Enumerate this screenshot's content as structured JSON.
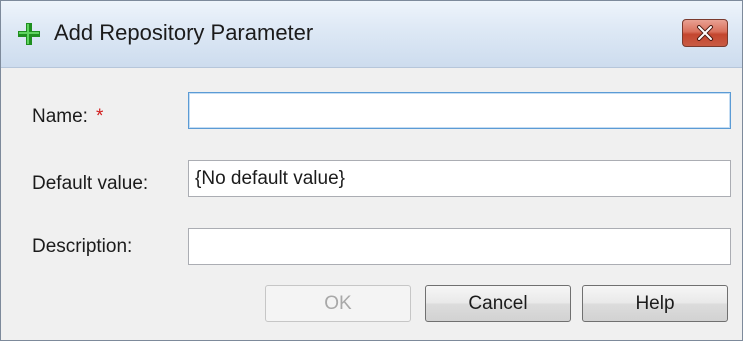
{
  "window": {
    "title": "Add Repository Parameter",
    "title_icon": "green-plus-icon",
    "close_icon": "close-icon",
    "accent_color": "#2e9d2e",
    "close_color": "#c4462f"
  },
  "form": {
    "name_label": "Name:",
    "required_marker": "*",
    "name_value": "",
    "default_label": "Default value:",
    "default_value": "{No default value}",
    "description_label": "Description:",
    "description_value": ""
  },
  "buttons": {
    "ok_label": "OK",
    "cancel_label": "Cancel",
    "help_label": "Help"
  }
}
